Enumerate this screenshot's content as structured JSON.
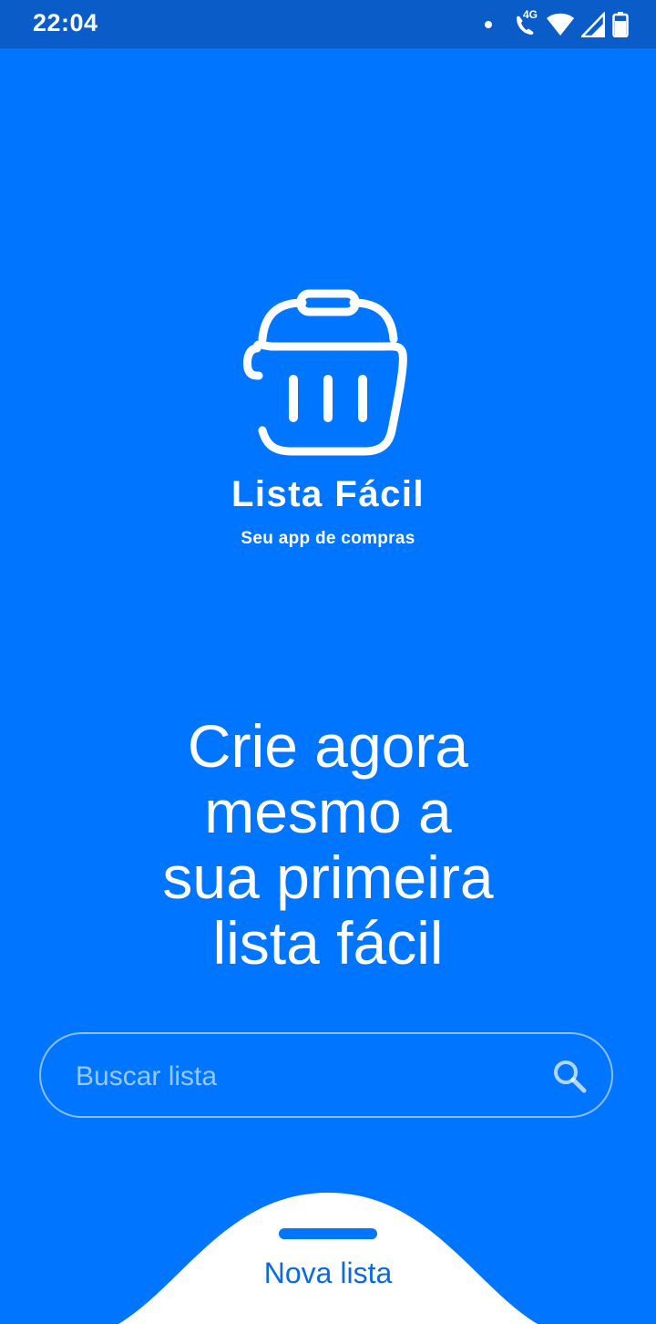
{
  "status_bar": {
    "time": "22:04",
    "network_label": "4G",
    "icons": [
      "notification-dot",
      "wifi-call-icon",
      "wifi-icon",
      "cell-signal-icon",
      "battery-icon"
    ]
  },
  "brand": {
    "logo_icon": "shopping-basket-icon",
    "name": "Lista Fácil",
    "tagline": "Seu app de compras"
  },
  "headline": {
    "lines": [
      "Crie agora",
      "mesmo a",
      "sua primeira",
      "lista fácil"
    ]
  },
  "search": {
    "placeholder": "Buscar lista",
    "value": "",
    "icon": "search-icon"
  },
  "bottom_sheet": {
    "action_label": "Nova lista"
  },
  "colors": {
    "background": "#0075FF",
    "status_bar": "#0A5DC8",
    "sheet": "#FFFFFF",
    "action_text": "#0A6BE0"
  }
}
